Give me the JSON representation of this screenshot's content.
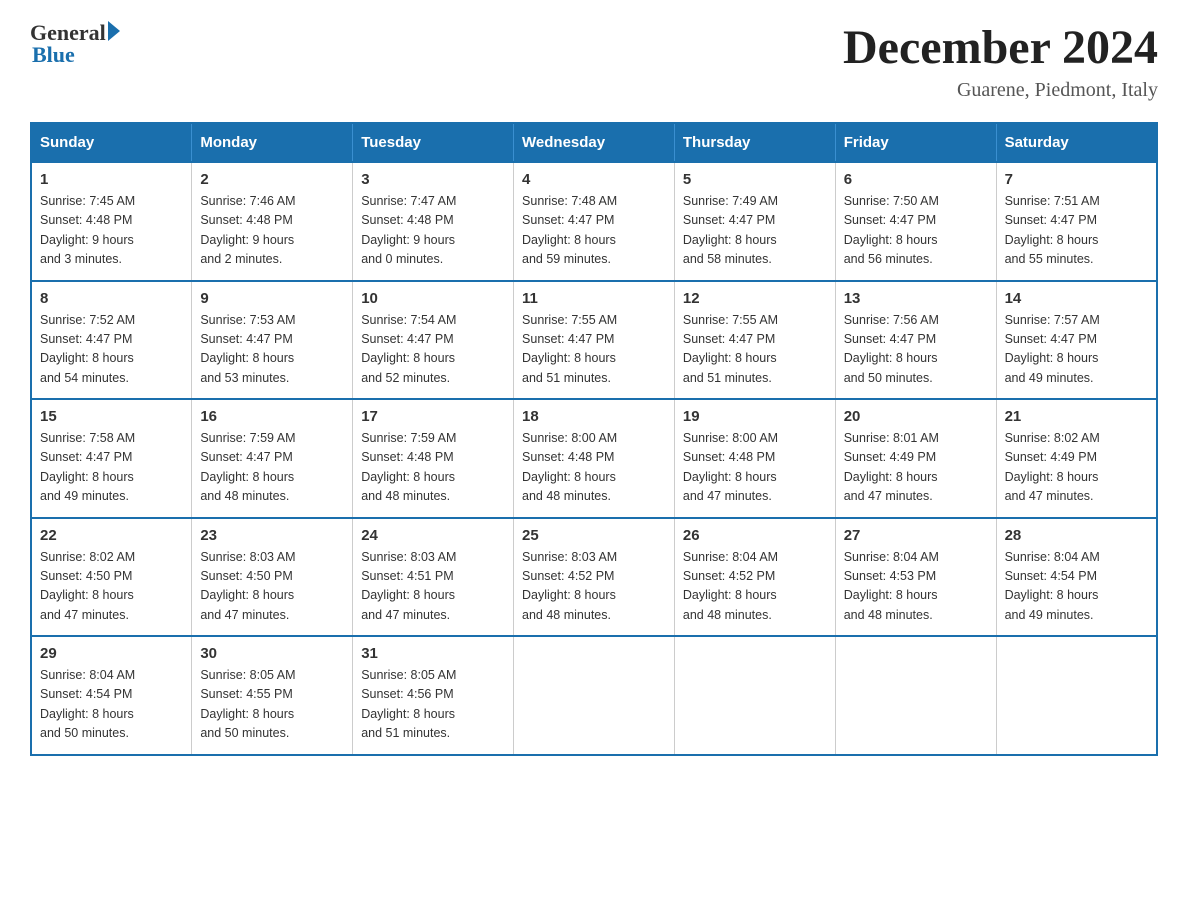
{
  "header": {
    "logo_general": "General",
    "logo_blue": "Blue",
    "month_title": "December 2024",
    "location": "Guarene, Piedmont, Italy"
  },
  "weekdays": [
    "Sunday",
    "Monday",
    "Tuesday",
    "Wednesday",
    "Thursday",
    "Friday",
    "Saturday"
  ],
  "weeks": [
    [
      {
        "day": "1",
        "sunrise": "7:45 AM",
        "sunset": "4:48 PM",
        "daylight": "9 hours and 3 minutes."
      },
      {
        "day": "2",
        "sunrise": "7:46 AM",
        "sunset": "4:48 PM",
        "daylight": "9 hours and 2 minutes."
      },
      {
        "day": "3",
        "sunrise": "7:47 AM",
        "sunset": "4:48 PM",
        "daylight": "9 hours and 0 minutes."
      },
      {
        "day": "4",
        "sunrise": "7:48 AM",
        "sunset": "4:47 PM",
        "daylight": "8 hours and 59 minutes."
      },
      {
        "day": "5",
        "sunrise": "7:49 AM",
        "sunset": "4:47 PM",
        "daylight": "8 hours and 58 minutes."
      },
      {
        "day": "6",
        "sunrise": "7:50 AM",
        "sunset": "4:47 PM",
        "daylight": "8 hours and 56 minutes."
      },
      {
        "day": "7",
        "sunrise": "7:51 AM",
        "sunset": "4:47 PM",
        "daylight": "8 hours and 55 minutes."
      }
    ],
    [
      {
        "day": "8",
        "sunrise": "7:52 AM",
        "sunset": "4:47 PM",
        "daylight": "8 hours and 54 minutes."
      },
      {
        "day": "9",
        "sunrise": "7:53 AM",
        "sunset": "4:47 PM",
        "daylight": "8 hours and 53 minutes."
      },
      {
        "day": "10",
        "sunrise": "7:54 AM",
        "sunset": "4:47 PM",
        "daylight": "8 hours and 52 minutes."
      },
      {
        "day": "11",
        "sunrise": "7:55 AM",
        "sunset": "4:47 PM",
        "daylight": "8 hours and 51 minutes."
      },
      {
        "day": "12",
        "sunrise": "7:55 AM",
        "sunset": "4:47 PM",
        "daylight": "8 hours and 51 minutes."
      },
      {
        "day": "13",
        "sunrise": "7:56 AM",
        "sunset": "4:47 PM",
        "daylight": "8 hours and 50 minutes."
      },
      {
        "day": "14",
        "sunrise": "7:57 AM",
        "sunset": "4:47 PM",
        "daylight": "8 hours and 49 minutes."
      }
    ],
    [
      {
        "day": "15",
        "sunrise": "7:58 AM",
        "sunset": "4:47 PM",
        "daylight": "8 hours and 49 minutes."
      },
      {
        "day": "16",
        "sunrise": "7:59 AM",
        "sunset": "4:47 PM",
        "daylight": "8 hours and 48 minutes."
      },
      {
        "day": "17",
        "sunrise": "7:59 AM",
        "sunset": "4:48 PM",
        "daylight": "8 hours and 48 minutes."
      },
      {
        "day": "18",
        "sunrise": "8:00 AM",
        "sunset": "4:48 PM",
        "daylight": "8 hours and 48 minutes."
      },
      {
        "day": "19",
        "sunrise": "8:00 AM",
        "sunset": "4:48 PM",
        "daylight": "8 hours and 47 minutes."
      },
      {
        "day": "20",
        "sunrise": "8:01 AM",
        "sunset": "4:49 PM",
        "daylight": "8 hours and 47 minutes."
      },
      {
        "day": "21",
        "sunrise": "8:02 AM",
        "sunset": "4:49 PM",
        "daylight": "8 hours and 47 minutes."
      }
    ],
    [
      {
        "day": "22",
        "sunrise": "8:02 AM",
        "sunset": "4:50 PM",
        "daylight": "8 hours and 47 minutes."
      },
      {
        "day": "23",
        "sunrise": "8:03 AM",
        "sunset": "4:50 PM",
        "daylight": "8 hours and 47 minutes."
      },
      {
        "day": "24",
        "sunrise": "8:03 AM",
        "sunset": "4:51 PM",
        "daylight": "8 hours and 47 minutes."
      },
      {
        "day": "25",
        "sunrise": "8:03 AM",
        "sunset": "4:52 PM",
        "daylight": "8 hours and 48 minutes."
      },
      {
        "day": "26",
        "sunrise": "8:04 AM",
        "sunset": "4:52 PM",
        "daylight": "8 hours and 48 minutes."
      },
      {
        "day": "27",
        "sunrise": "8:04 AM",
        "sunset": "4:53 PM",
        "daylight": "8 hours and 48 minutes."
      },
      {
        "day": "28",
        "sunrise": "8:04 AM",
        "sunset": "4:54 PM",
        "daylight": "8 hours and 49 minutes."
      }
    ],
    [
      {
        "day": "29",
        "sunrise": "8:04 AM",
        "sunset": "4:54 PM",
        "daylight": "8 hours and 50 minutes."
      },
      {
        "day": "30",
        "sunrise": "8:05 AM",
        "sunset": "4:55 PM",
        "daylight": "8 hours and 50 minutes."
      },
      {
        "day": "31",
        "sunrise": "8:05 AM",
        "sunset": "4:56 PM",
        "daylight": "8 hours and 51 minutes."
      },
      null,
      null,
      null,
      null
    ]
  ],
  "labels": {
    "sunrise": "Sunrise:",
    "sunset": "Sunset:",
    "daylight": "Daylight:"
  }
}
